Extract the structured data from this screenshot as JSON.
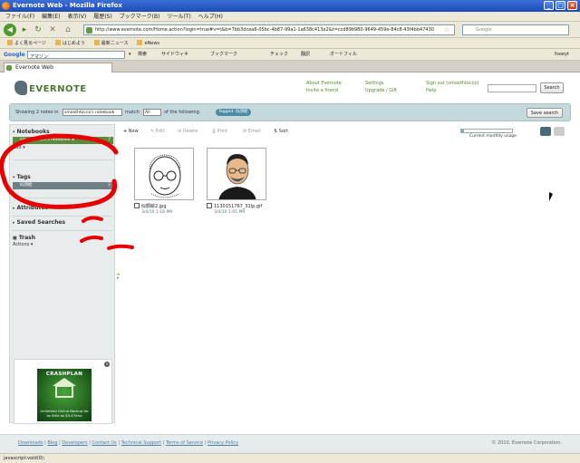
{
  "window": {
    "title": "Evernote Web - Mozilla Firefox"
  },
  "menu": [
    "ファイル(F)",
    "編集(E)",
    "表示(V)",
    "履歴(S)",
    "ブックマーク(B)",
    "ツール(T)",
    "ヘルプ(H)"
  ],
  "address": {
    "url": "http://www.evernote.com/Home.action?login=true#v=t&b=7bb3dcea6-05bc-4b87-99a1-1a638c413e2&t=ccd89b980-9649-459e-84c8-43f4bb47430",
    "search_placeholder": "Google"
  },
  "bookmarks": [
    "よく見るページ",
    "はじめよう",
    "最新ニュース",
    "eNews"
  ],
  "google_toolbar": {
    "label": "Google",
    "input_value": "アマゾン",
    "items": [
      "検索",
      "サイドウィキ",
      "ブックマーク",
      "チェック",
      "翻訳",
      "オートフィル"
    ],
    "account": "fooeyt"
  },
  "tab": {
    "label": "Evernote Web"
  },
  "header": {
    "logo": "EVERNOTE",
    "links_col1": [
      "About Evernote",
      "Invite a friend"
    ],
    "links_col2": [
      "Settings",
      "Upgrade / Gift"
    ],
    "links_col3": [
      "Sign out (smoothtocco)",
      "Help"
    ],
    "search_button": "Search"
  },
  "filter": {
    "showing": "Showing 2 notes in",
    "notebook_select": "smoothtocco's notebook",
    "match": "match",
    "match_select": "All",
    "of_following": "of the following:",
    "tag_chip": "Tagged: 似顔絵",
    "save_search": "Save search"
  },
  "sidebar": {
    "notebooks_title": "Notebooks",
    "notebook_name": "smoothtocco's notebook ★",
    "notebook_count": "7",
    "edit_label": "Edit",
    "tags_title": "Tags",
    "tag_name": "似顔絵",
    "tag_count": "2",
    "attributes_title": "Attributes",
    "saved_searches_title": "Saved Searches",
    "trash_title": "Trash",
    "actions_label": "Actions"
  },
  "ad": {
    "title": "CRASHPLAN",
    "text": "Unlimited Online Backup for as little as $3.47/mo"
  },
  "toolbar": {
    "new": "New",
    "edit": "Edit",
    "delete": "Delete",
    "print": "Print",
    "email": "Email",
    "sort": "Sort",
    "usage_label": "Current monthly usage",
    "usage_fraction": 0.05
  },
  "notes": [
    {
      "title": "似顔絵2.jpg",
      "date": "3/4/10 1:18 PM"
    },
    {
      "title": "1130151767_31lp.gif",
      "date": "3/4/10 1:05 PM"
    }
  ],
  "footer": {
    "links": [
      "Downloads",
      "Blog",
      "Developers",
      "Contact Us",
      "Technical Support",
      "Terms of Service",
      "Privacy Policy"
    ],
    "copyright": "© 2010, Evernote Corporation."
  },
  "status": "javascript:void(0);",
  "colors": {
    "brand_green": "#5d8b3e",
    "filter_bar": "#c4d9dc",
    "annotation_red": "#e80000"
  }
}
